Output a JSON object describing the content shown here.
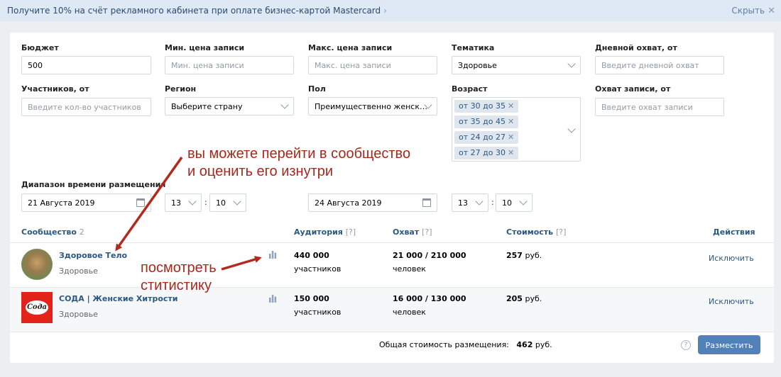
{
  "promo": {
    "text": "Получите 10% на счёт рекламного кабинета при оплате бизнес-картой Mastercard",
    "chevron": "›",
    "hide_label": "Скрыть",
    "hide_icon": "✕"
  },
  "filters": {
    "budget": {
      "label": "Бюджет",
      "value": "500"
    },
    "min_price": {
      "label": "Мин. цена записи",
      "placeholder": "Мин. цена записи"
    },
    "max_price": {
      "label": "Макс. цена записи",
      "placeholder": "Макс. цена записи"
    },
    "topic": {
      "label": "Тематика",
      "value": "Здоровье"
    },
    "daily_reach": {
      "label": "Дневной охват, от",
      "placeholder": "Введите дневной охват"
    },
    "members": {
      "label": "Участников, от",
      "placeholder": "Введите кол-во участников"
    },
    "region": {
      "label": "Регион",
      "value": "Выберите страну"
    },
    "gender": {
      "label": "Пол",
      "value": "Преимущественно женск…"
    },
    "age": {
      "label": "Возраст",
      "tags": [
        "от 30 до 35",
        "от 35 до 45",
        "от 24 до 27",
        "от 27 до 30"
      ]
    },
    "post_reach": {
      "label": "Охват записи, от",
      "placeholder": "Введите охват записи"
    },
    "time_range": {
      "label": "Диапазон времени размещения",
      "start_date": "21 Августа 2019",
      "start_hour": "13",
      "start_min": "10",
      "end_date": "24 Августа 2019",
      "end_hour": "13",
      "end_min": "10",
      "colon": ":"
    }
  },
  "table": {
    "headers": {
      "community": "Сообщество",
      "community_count": "2",
      "audience": "Аудитория",
      "reach": "Охват",
      "cost": "Стоимость",
      "actions": "Действия",
      "help_mark": "[?]"
    },
    "rows": [
      {
        "name": "Здоровое Тело",
        "category": "Здоровье",
        "audience": "440 000",
        "audience_unit": "участников",
        "reach": "21 000 / 210 000",
        "reach_unit": "человек",
        "cost": "257",
        "cost_unit": " руб.",
        "action": "Исключить"
      },
      {
        "name": "СОДА | Женские Хитрости",
        "category": "Здоровье",
        "audience": "150 000",
        "audience_unit": "участников",
        "reach": "16 000 / 130 000",
        "reach_unit": "человек",
        "cost": "205",
        "cost_unit": " руб.",
        "action": "Исключить",
        "logo_text": "Сода"
      }
    ]
  },
  "footer": {
    "total_label": "Общая стоимость размещения:",
    "total_value": "462",
    "total_unit": " руб.",
    "help": "?",
    "place_button": "Разместить"
  },
  "annotations": {
    "top_line1": "вы можете перейти в сообщество",
    "top_line2": "и оценить его изнутри",
    "stats_line1": "посмотреть",
    "stats_line2": "ститистику"
  },
  "colors": {
    "accent": "#5181b8",
    "link": "#2a5885",
    "annotation": "#a8281b"
  }
}
